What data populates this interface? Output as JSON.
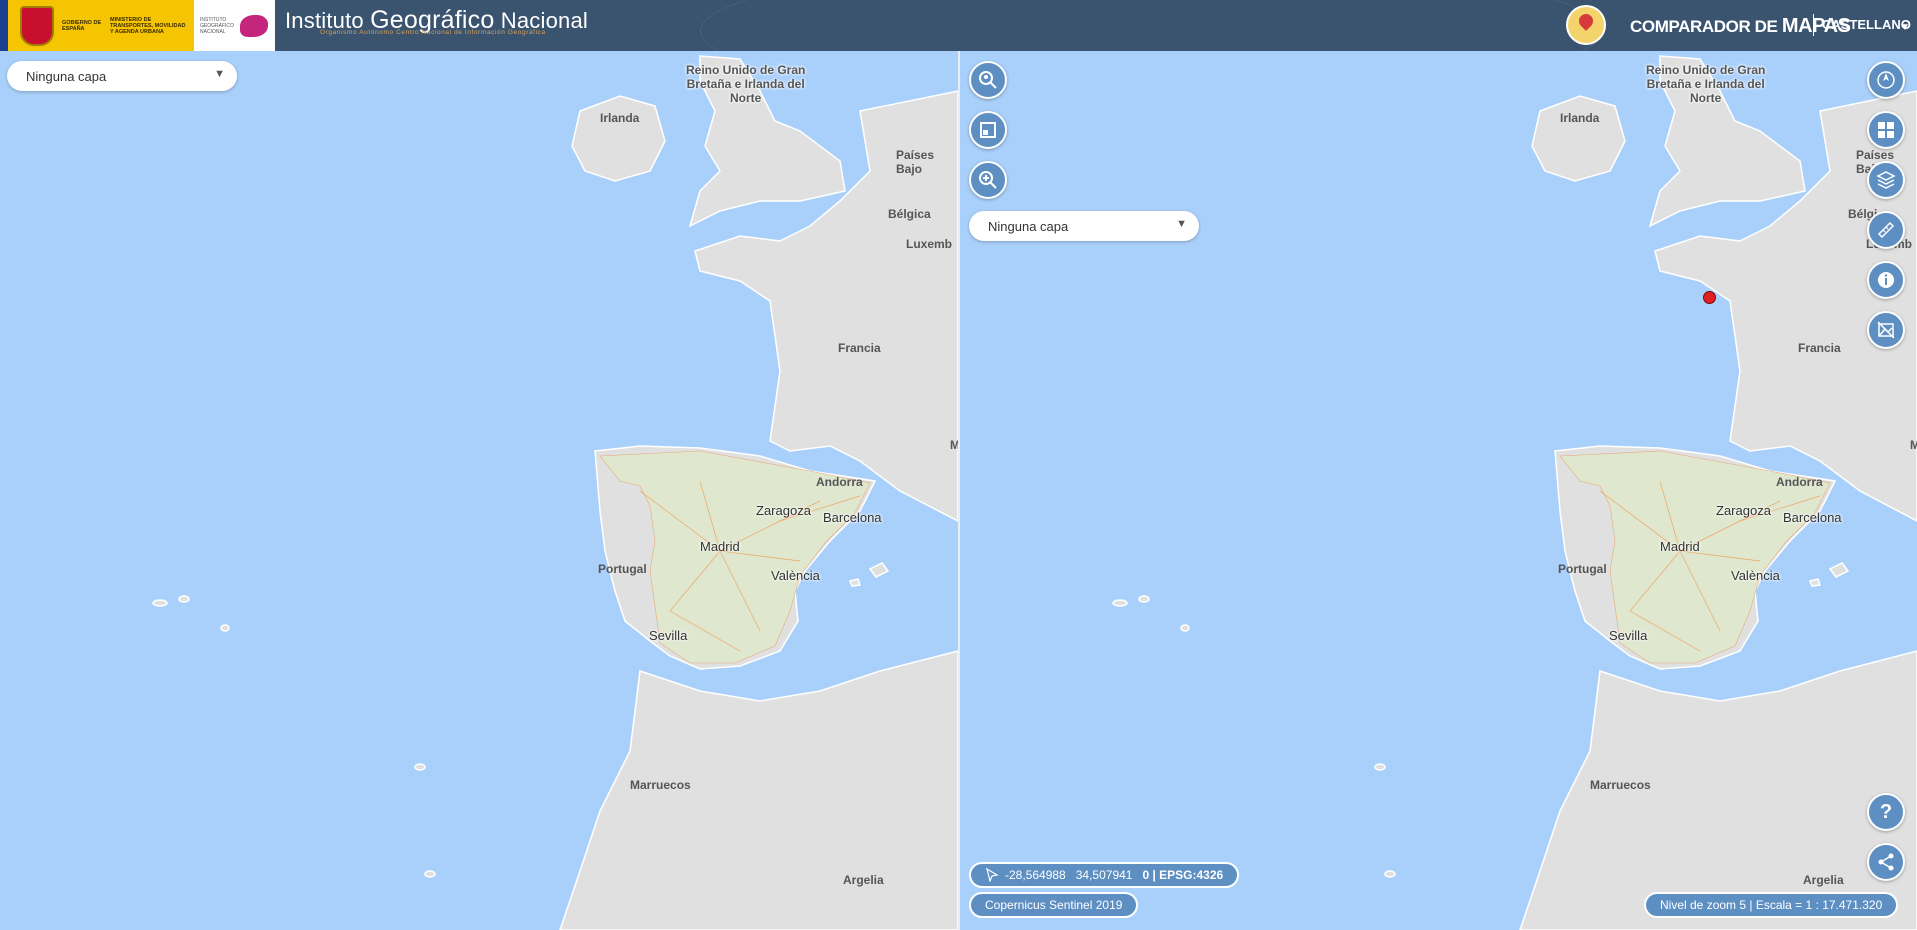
{
  "header": {
    "gov_text": "GOBIERNO DE ESPAÑA",
    "ministry_text": "MINISTERIO DE TRANSPORTES, MOVILIDAD Y AGENDA URBANA",
    "ign_small_text": "INSTITUTO GEOGRÁFICO NACIONAL",
    "title_prefix": "Instituto",
    "title_main": "Geográfico",
    "title_suffix": "Nacional",
    "subtitle": "Organismo Autónomo Centro Nacional de Información Geográfica",
    "app_title_prefix": "COMPARADOR DE",
    "app_title_strong": "MAPAS",
    "language": "CASTELLANO"
  },
  "left_panel": {
    "layer_select": "Ninguna capa",
    "labels": {
      "uk": [
        "Reino Unido de Gran",
        "Bretaña e Irlanda del",
        "Norte"
      ],
      "ireland": "Irlanda",
      "netherlands": "Países Bajo",
      "belgium": "Bélgica",
      "luxembourg": "Luxemb",
      "france": "Francia",
      "monaco": "M",
      "andorra": "Andorra",
      "portugal": "Portugal",
      "morocco": "Marruecos",
      "algeria": "Argelia"
    },
    "cities": {
      "zaragoza": "Zaragoza",
      "barcelona": "Barcelona",
      "madrid": "Madrid",
      "valencia": "València",
      "sevilla": "Sevilla"
    }
  },
  "right_panel": {
    "layer_select": "Ninguna capa",
    "labels": {
      "uk": [
        "Reino Unido de Gran",
        "Bretaña e Irlanda del",
        "Norte"
      ],
      "ireland": "Irlanda",
      "netherlands": "Países Bajo",
      "belgium": "Bélgi",
      "luxembourg": "Luxemb",
      "france": "Francia",
      "monaco": "M",
      "andorra": "Andorra",
      "portugal": "Portugal",
      "morocco": "Marruecos",
      "algeria": "Argelia"
    },
    "cities": {
      "zaragoza": "Zaragoza",
      "barcelona": "Barcelona",
      "madrid": "Madrid",
      "valencia": "València",
      "sevilla": "Sevilla"
    },
    "coordinates": {
      "lon": "-28,564988",
      "lat": "34,507941",
      "rest": "0 | EPSG:4326"
    },
    "base_layer": "Copernicus Sentinel 2019",
    "zoom_scale": "Nivel de zoom 5 | Escala = 1 : 17.471.320"
  },
  "colors": {
    "sea": "#a9d0fa",
    "land": "#e0e0e0",
    "header": "#3a5470",
    "button": "#5d8fc3"
  }
}
